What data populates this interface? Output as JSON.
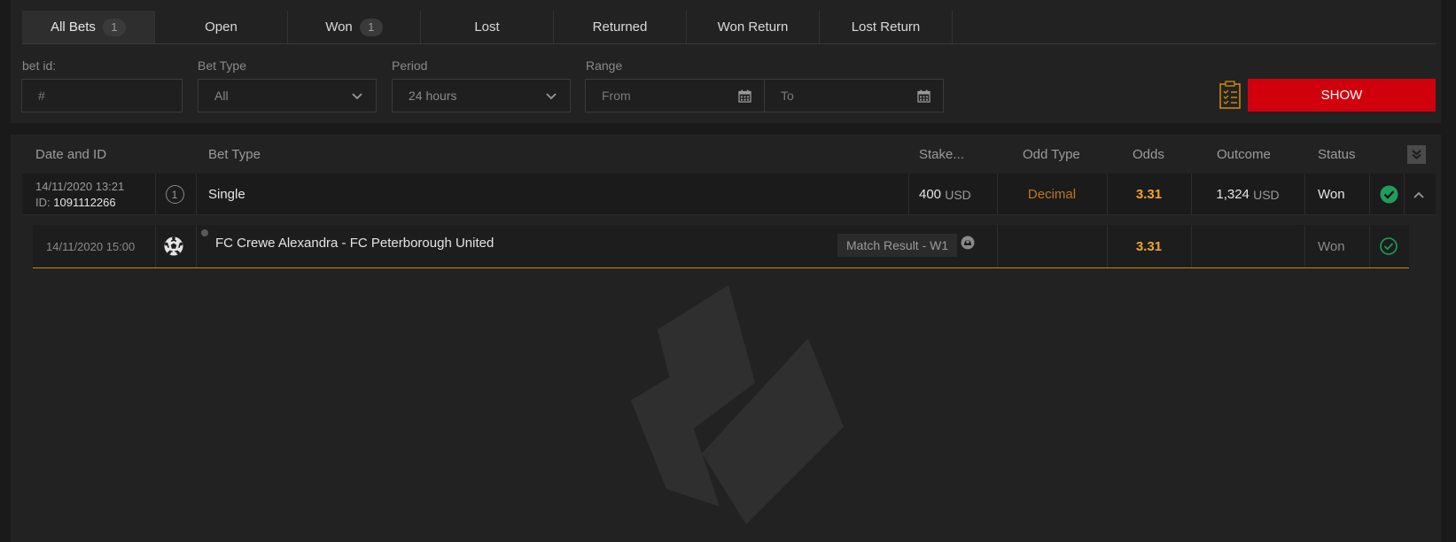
{
  "tabs": [
    {
      "label": "All Bets",
      "count": "1"
    },
    {
      "label": "Open",
      "count": ""
    },
    {
      "label": "Won",
      "count": "1"
    },
    {
      "label": "Lost",
      "count": ""
    },
    {
      "label": "Returned",
      "count": ""
    },
    {
      "label": "Won Return",
      "count": ""
    },
    {
      "label": "Lost Return",
      "count": ""
    }
  ],
  "filters": {
    "bet_id_label": "bet id:",
    "bet_id_placeholder": "#",
    "bet_type_label": "Bet Type",
    "bet_type_value": "All",
    "period_label": "Period",
    "period_value": "24 hours",
    "range_label": "Range",
    "from_placeholder": "From",
    "to_placeholder": "To",
    "show_label": "SHOW"
  },
  "table": {
    "headers": {
      "date_id": "Date and ID",
      "bet_type": "Bet Type",
      "stake": "Stake...",
      "odd_type": "Odd Type",
      "odds": "Odds",
      "outcome": "Outcome",
      "status": "Status"
    },
    "bet": {
      "datetime": "14/11/2020 13:21",
      "id_label": "ID:",
      "id": "1091112266",
      "selections": "1",
      "bet_type": "Single",
      "stake": "400",
      "stake_currency": "USD",
      "odd_type": "Decimal",
      "odds": "3.31",
      "outcome": "1,324",
      "outcome_currency": "USD",
      "status": "Won"
    },
    "event": {
      "datetime": "14/11/2020 15:00",
      "sport_icon": "soccer-ball-icon",
      "name": "FC Crewe Alexandra - FC Peterborough United",
      "market": "Match Result - W1",
      "odds": "3.31",
      "status": "Won"
    }
  },
  "colors": {
    "accent_red": "#d0000d",
    "odds_orange": "#f0a52b",
    "won_green": "#1e9e5a",
    "row_underline": "#c8870b"
  }
}
